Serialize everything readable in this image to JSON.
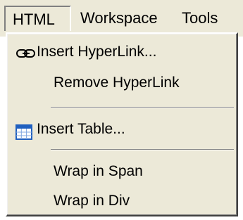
{
  "menubar": {
    "items": [
      {
        "label": "HTML"
      },
      {
        "label": "Workspace"
      },
      {
        "label": "Tools"
      }
    ]
  },
  "menu": {
    "insert_hyperlink": {
      "label": "Insert HyperLink...",
      "icon": "link-icon"
    },
    "remove_hyperlink": {
      "label": "Remove HyperLink"
    },
    "insert_table": {
      "label": "Insert Table...",
      "icon": "table-icon"
    },
    "wrap_span": {
      "label": "Wrap in Span"
    },
    "wrap_div": {
      "label": "Wrap in Div"
    }
  },
  "colors": {
    "menu_background": "#ece9d8",
    "text": "#000000",
    "table_icon_header": "#1f5fbf"
  }
}
